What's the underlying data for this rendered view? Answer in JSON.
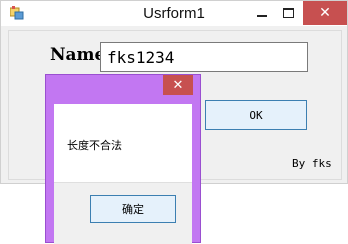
{
  "window": {
    "title": "Usrform1",
    "close_glyph": "✕"
  },
  "form": {
    "name_label": "Name",
    "name_value": "fks1234",
    "ok_label": "OK",
    "footer_text": "By fks"
  },
  "dialog": {
    "message": "长度不合法",
    "confirm_label": "确定",
    "close_glyph": "✕"
  },
  "colors": {
    "dialog_frame": "#c277f2",
    "close_button": "#c75050",
    "button_border": "#3c7fb1"
  }
}
